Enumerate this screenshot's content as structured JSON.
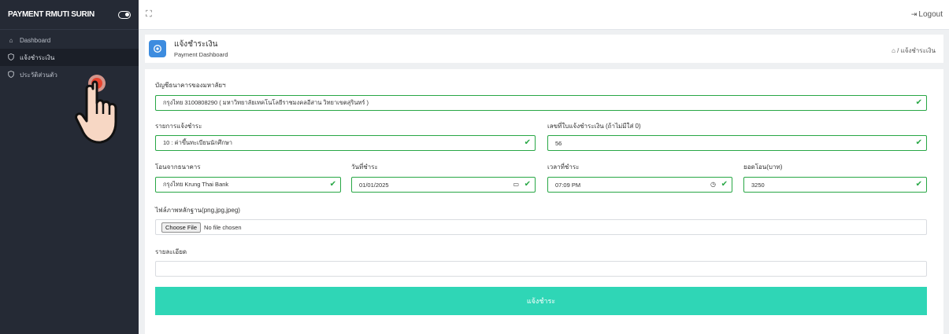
{
  "sidebar": {
    "brand": "PAYMENT RMUTI SURIN",
    "items": [
      {
        "label": "Dashboard",
        "icon": "home-icon"
      },
      {
        "label": "แจ้งชำระเงิน",
        "icon": "shield-icon"
      },
      {
        "label": "ประวัติส่วนตัว",
        "icon": "shield-icon"
      }
    ]
  },
  "topbar": {
    "logout_label": "Logout"
  },
  "header": {
    "title": "แจ้งชำระเงิน",
    "subtitle": "Payment Dashboard",
    "breadcrumb_sep": "/",
    "breadcrumb_current": "แจ้งชำระเงิน"
  },
  "form": {
    "university_account_label": "บัญชีธนาคารของมหาลัยฯ",
    "university_account_value": "กรุงไทย 3100808290 ( มหาวิทยาลัยเทคโนโลยีราชมงคลอีสาน วิทยาเขตสุรินทร์ )",
    "payment_item_label": "รายการแจ้งชำระ",
    "payment_item_value": "10 : ค่าขึ้นทะเบียนนักศึกษา",
    "receipt_no_label": "เลขที่ใบแจ้งชำระเงิน (ถ้าไม่มีใส่ 0)",
    "receipt_no_value": "56",
    "bank_label": "โอนจากธนาคาร",
    "bank_value": "กรุงไทย Krung Thai Bank",
    "date_label": "วันที่ชำระ",
    "date_value": "01/01/2025",
    "time_label": "เวลาที่ชำระ",
    "time_value": "07:09 PM",
    "amount_label": "ยอดโอน(บาท)",
    "amount_value": "3250",
    "file_label": "ไฟล์ภาพหลักฐาน(png,jpg,jpeg)",
    "file_button": "Choose File",
    "file_status": "No file chosen",
    "detail_label": "รายละเอียด",
    "detail_value": "",
    "submit_label": "แจ้งชำระ"
  },
  "colors": {
    "accent": "#2fd6b6",
    "valid": "#28a745",
    "sidebar": "#252a35",
    "header_icon": "#3d8cdf"
  }
}
